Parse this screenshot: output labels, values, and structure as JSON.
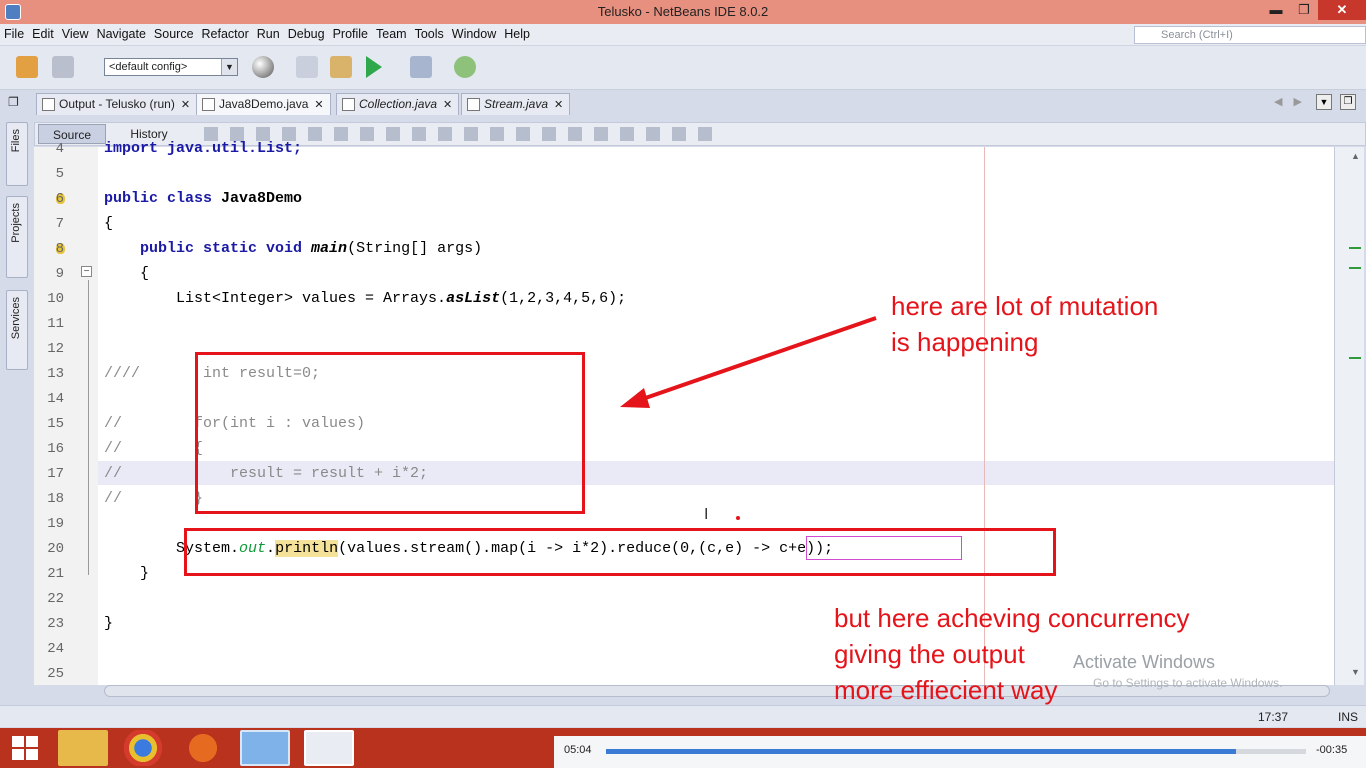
{
  "window": {
    "title": "Telusko - NetBeans IDE 8.0.2",
    "min": "▬",
    "max": "❐",
    "close": "✕"
  },
  "menubar": {
    "items": [
      "File",
      "Edit",
      "View",
      "Navigate",
      "Source",
      "Refactor",
      "Run",
      "Debug",
      "Profile",
      "Team",
      "Tools",
      "Window",
      "Help"
    ],
    "search_placeholder": "Search (Ctrl+I)"
  },
  "toolbar": {
    "config": "<default config>"
  },
  "tabs": [
    {
      "label": "Output - Telusko (run)",
      "active": false,
      "italic": false
    },
    {
      "label": "Java8Demo.java",
      "active": true,
      "italic": false
    },
    {
      "label": "Collection.java",
      "active": false,
      "italic": true
    },
    {
      "label": "Stream.java",
      "active": false,
      "italic": true
    }
  ],
  "side_panels": [
    "Files",
    "Projects",
    "Services"
  ],
  "editor_tabs": {
    "source": "Source",
    "history": "History"
  },
  "code_lines": [
    {
      "n": "4",
      "text": "import java.util.List;"
    },
    {
      "n": "5",
      "text": ""
    },
    {
      "n": "6",
      "text": "public class Java8Demo"
    },
    {
      "n": "7",
      "text": "{"
    },
    {
      "n": "8",
      "text": "    public static void main(String[] args)"
    },
    {
      "n": "9",
      "text": "    {"
    },
    {
      "n": "10",
      "text": "        List<Integer> values = Arrays.asList(1,2,3,4,5,6);"
    },
    {
      "n": "11",
      "text": ""
    },
    {
      "n": "12",
      "text": ""
    },
    {
      "n": "13",
      "text": "////       int result=0;"
    },
    {
      "n": "14",
      "text": ""
    },
    {
      "n": "15",
      "text": "//        for(int i : values)"
    },
    {
      "n": "16",
      "text": "//        {"
    },
    {
      "n": "17",
      "text": "//            result = result + i*2;"
    },
    {
      "n": "18",
      "text": "//        }"
    },
    {
      "n": "19",
      "text": ""
    },
    {
      "n": "20",
      "text": "        System.out.println(values.stream().map(i -> i*2).reduce(0,(c,e) -> c+e));"
    },
    {
      "n": "21",
      "text": "    }"
    },
    {
      "n": "22",
      "text": ""
    },
    {
      "n": "23",
      "text": "}"
    },
    {
      "n": "24",
      "text": ""
    },
    {
      "n": "25",
      "text": ""
    }
  ],
  "annotations": {
    "top_line1": "here are lot of mutation",
    "top_line2": "is happening",
    "bottom_line1": "but here acheving concurrency",
    "bottom_line2": "giving the output",
    "bottom_line3": "more effiecient way"
  },
  "watermark": {
    "line1": "Activate Windows",
    "line2": "Go to Settings to activate Windows."
  },
  "statusbar": {
    "position": "17:37",
    "mode": "INS"
  },
  "player": {
    "elapsed": "05:04",
    "remaining": "-00:35",
    "progress": 0.9
  },
  "colors": {
    "annotation": "#e5141b",
    "keyword": "#1a1aa6",
    "comment": "#8a8a8a",
    "field": "#0e9a3a",
    "taskbar": "#b8321d"
  }
}
